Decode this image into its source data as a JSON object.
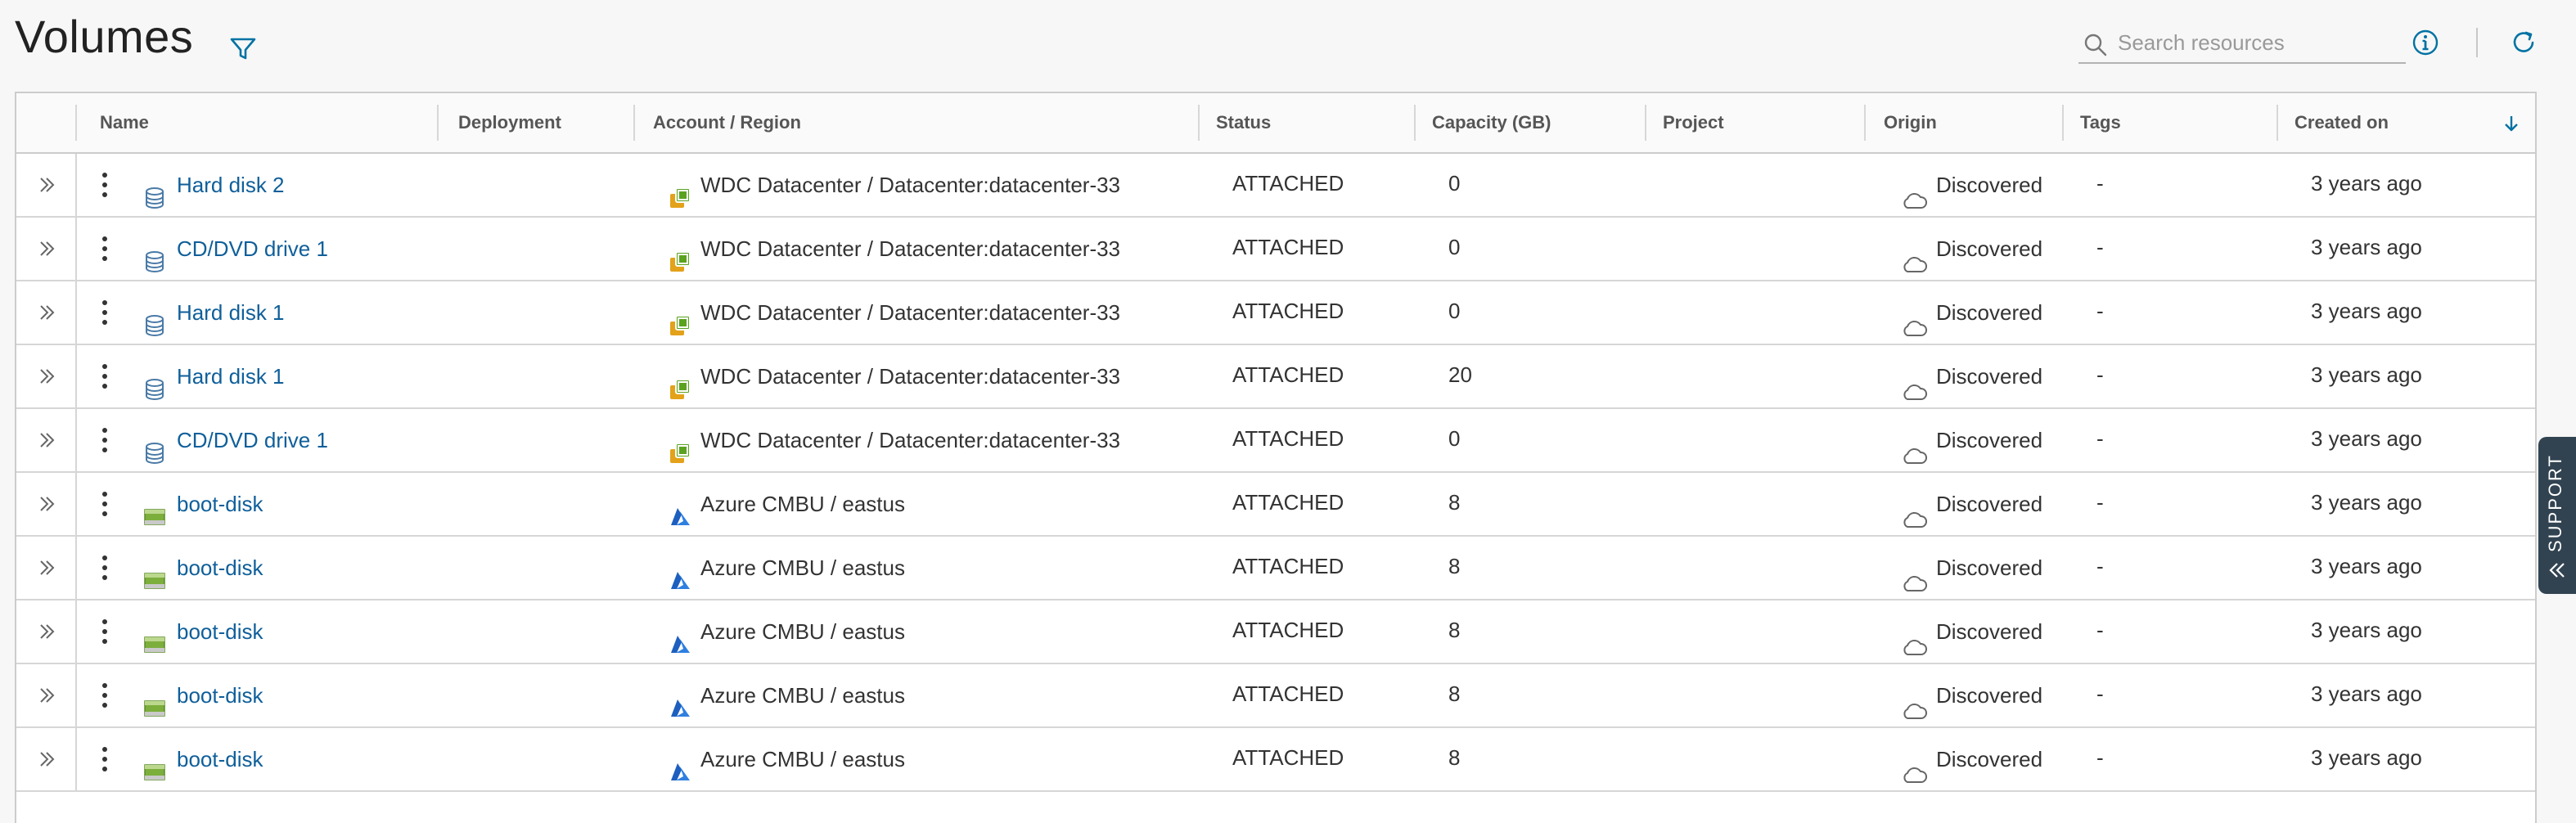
{
  "header": {
    "title": "Volumes",
    "search_placeholder": "Search resources"
  },
  "columns": [
    {
      "key": "name",
      "label": "Name"
    },
    {
      "key": "deployment",
      "label": "Deployment"
    },
    {
      "key": "account",
      "label": "Account / Region"
    },
    {
      "key": "status",
      "label": "Status"
    },
    {
      "key": "capacity",
      "label": "Capacity (GB)"
    },
    {
      "key": "project",
      "label": "Project"
    },
    {
      "key": "origin",
      "label": "Origin"
    },
    {
      "key": "tags",
      "label": "Tags"
    },
    {
      "key": "created",
      "label": "Created on"
    }
  ],
  "sort": {
    "column": "created",
    "direction": "descending"
  },
  "rows": [
    {
      "name": "Hard disk 2",
      "disk_type": "vsphere",
      "account_type": "vsphere",
      "account": "WDC Datacenter / Datacenter:datacenter-33",
      "status": "ATTACHED",
      "capacity": "0",
      "origin": "Discovered",
      "tags": "-",
      "created": "3 years ago"
    },
    {
      "name": "CD/DVD drive 1",
      "disk_type": "vsphere",
      "account_type": "vsphere",
      "account": "WDC Datacenter / Datacenter:datacenter-33",
      "status": "ATTACHED",
      "capacity": "0",
      "origin": "Discovered",
      "tags": "-",
      "created": "3 years ago"
    },
    {
      "name": "Hard disk 1",
      "disk_type": "vsphere",
      "account_type": "vsphere",
      "account": "WDC Datacenter / Datacenter:datacenter-33",
      "status": "ATTACHED",
      "capacity": "0",
      "origin": "Discovered",
      "tags": "-",
      "created": "3 years ago"
    },
    {
      "name": "Hard disk 1",
      "disk_type": "vsphere",
      "account_type": "vsphere",
      "account": "WDC Datacenter / Datacenter:datacenter-33",
      "status": "ATTACHED",
      "capacity": "20",
      "origin": "Discovered",
      "tags": "-",
      "created": "3 years ago"
    },
    {
      "name": "CD/DVD drive 1",
      "disk_type": "vsphere",
      "account_type": "vsphere",
      "account": "WDC Datacenter / Datacenter:datacenter-33",
      "status": "ATTACHED",
      "capacity": "0",
      "origin": "Discovered",
      "tags": "-",
      "created": "3 years ago"
    },
    {
      "name": "boot-disk",
      "disk_type": "azure",
      "account_type": "azure",
      "account": "Azure CMBU / eastus",
      "status": "ATTACHED",
      "capacity": "8",
      "origin": "Discovered",
      "tags": "-",
      "created": "3 years ago"
    },
    {
      "name": "boot-disk",
      "disk_type": "azure",
      "account_type": "azure",
      "account": "Azure CMBU / eastus",
      "status": "ATTACHED",
      "capacity": "8",
      "origin": "Discovered",
      "tags": "-",
      "created": "3 years ago"
    },
    {
      "name": "boot-disk",
      "disk_type": "azure",
      "account_type": "azure",
      "account": "Azure CMBU / eastus",
      "status": "ATTACHED",
      "capacity": "8",
      "origin": "Discovered",
      "tags": "-",
      "created": "3 years ago"
    },
    {
      "name": "boot-disk",
      "disk_type": "azure",
      "account_type": "azure",
      "account": "Azure CMBU / eastus",
      "status": "ATTACHED",
      "capacity": "8",
      "origin": "Discovered",
      "tags": "-",
      "created": "3 years ago"
    },
    {
      "name": "boot-disk",
      "disk_type": "azure",
      "account_type": "azure",
      "account": "Azure CMBU / eastus",
      "status": "ATTACHED",
      "capacity": "8",
      "origin": "Discovered",
      "tags": "-",
      "created": "3 years ago"
    }
  ],
  "support": {
    "label": "SUPPORT"
  },
  "icons": {
    "filter": "filter-icon",
    "search": "search-icon",
    "info": "info-icon",
    "refresh": "refresh-icon",
    "expand": "double-chevron-right-icon",
    "row_actions": "kebab-menu-icon",
    "vsphere_disk": "database-disk-icon",
    "azure_disk": "disk-drive-icon",
    "vsphere_account": "vsphere-icon",
    "azure_account": "azure-icon",
    "origin": "cloud-icon",
    "sort": "arrow-down-icon",
    "support": "double-chevron-left-icon"
  },
  "colors": {
    "link": "#0f5f9a",
    "accent": "#0072a3",
    "support_bg": "#314351",
    "vsphere_orange": "#e3a21a",
    "vsphere_green": "#5aa220",
    "azure_blue": "#1d5fbf"
  }
}
